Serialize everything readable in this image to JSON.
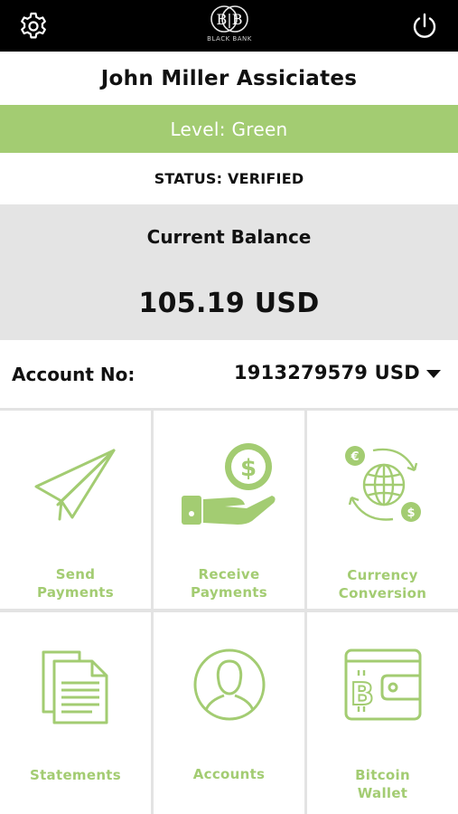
{
  "header": {
    "logo_letters": "BB",
    "logo_text": "BLACK BANK",
    "settings_icon": "gear-icon",
    "power_icon": "power-icon"
  },
  "account_holder": "John Miller Assiciates",
  "level": "Level: Green",
  "status": "STATUS: VERIFIED",
  "balance": {
    "label": "Current Balance",
    "value": "105.19 USD"
  },
  "account": {
    "label": "Account No:",
    "value": "1913279579 USD"
  },
  "tiles": [
    {
      "line1": "Send",
      "line2": "Payments",
      "icon": "paper-plane-icon"
    },
    {
      "line1": "Receive",
      "line2": "Payments",
      "icon": "hand-coin-icon"
    },
    {
      "line1": "Currency",
      "line2": "Conversion",
      "icon": "globe-exchange-icon"
    },
    {
      "line1": "Statements",
      "line2": "",
      "icon": "document-icon"
    },
    {
      "line1": "Accounts",
      "line2": "",
      "icon": "user-circle-icon"
    },
    {
      "line1": "Bitcoin",
      "line2": "Wallet",
      "icon": "bitcoin-wallet-icon"
    }
  ],
  "colors": {
    "accent": "#a3cc72",
    "topbar": "#000000",
    "balance_bg": "#e4e4e4"
  }
}
